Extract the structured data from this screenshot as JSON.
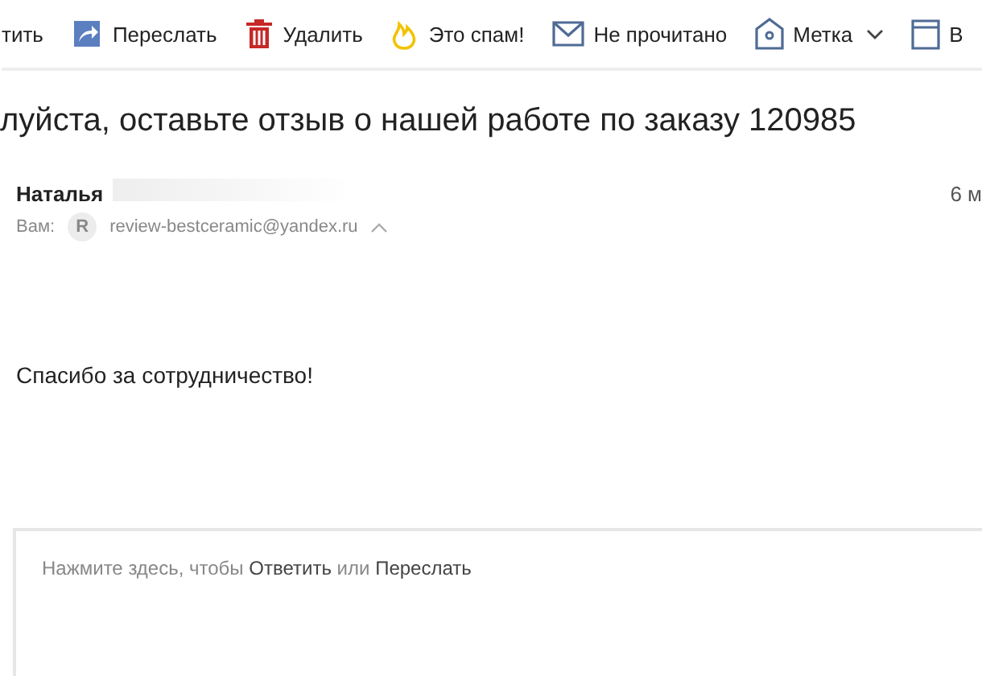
{
  "toolbar": [
    {
      "kind": "text",
      "label": "тить"
    },
    {
      "kind": "forward",
      "label": "Переслать"
    },
    {
      "kind": "delete",
      "label": "Удалить"
    },
    {
      "kind": "spam",
      "label": "Это спам!"
    },
    {
      "kind": "unread",
      "label": "Не прочитано"
    },
    {
      "kind": "label",
      "label": "Метка"
    },
    {
      "kind": "folder",
      "label": "В"
    }
  ],
  "subject": "луйста, оставьте отзыв о нашей работе по заказу 120985",
  "sender": {
    "name": "Наталья",
    "to_label": "Вам:",
    "avatar": "R",
    "recipient": "review-bestceramic@yandex.ru",
    "date": "6 м"
  },
  "body": "Спасибо за сотрудничество!",
  "reply": {
    "hint_parts": [
      {
        "kind": "text",
        "text": "Нажмите здесь, чтобы"
      },
      {
        "kind": "link",
        "text": "Ответить"
      },
      {
        "kind": "text",
        "text": "или"
      },
      {
        "kind": "link",
        "text": "Переслать"
      }
    ]
  }
}
